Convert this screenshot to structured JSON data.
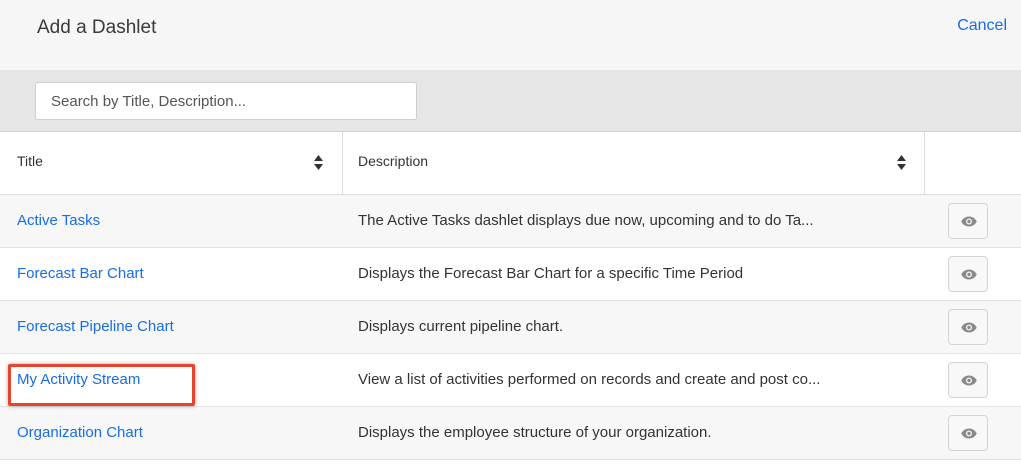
{
  "header": {
    "title": "Add a Dashlet",
    "cancel_label": "Cancel"
  },
  "search": {
    "placeholder": "Search by Title, Description...",
    "value": ""
  },
  "table": {
    "columns": [
      {
        "label": "Title",
        "icon": "sort-icon"
      },
      {
        "label": "Description",
        "icon": "sort-icon"
      },
      {
        "label": ""
      }
    ],
    "rows": [
      {
        "title": "Active Tasks",
        "description": "The Active Tasks dashlet displays due now, upcoming and to do Ta...",
        "action_icon": "eye-icon"
      },
      {
        "title": "Forecast Bar Chart",
        "description": "Displays the Forecast Bar Chart for a specific Time Period",
        "action_icon": "eye-icon"
      },
      {
        "title": "Forecast Pipeline Chart",
        "description": "Displays current pipeline chart.",
        "action_icon": "eye-icon"
      },
      {
        "title": "My Activity Stream",
        "description": "View a list of activities performed on records and create and post co...",
        "action_icon": "eye-icon",
        "highlighted": true
      },
      {
        "title": "Organization Chart",
        "description": "Displays the employee structure of your organization.",
        "action_icon": "eye-icon"
      }
    ]
  },
  "colors": {
    "link": "#176de5",
    "highlight_border": "#e8442d",
    "filter_bar_bg": "#e6e6e6",
    "header_bg": "#f6f6f6"
  }
}
